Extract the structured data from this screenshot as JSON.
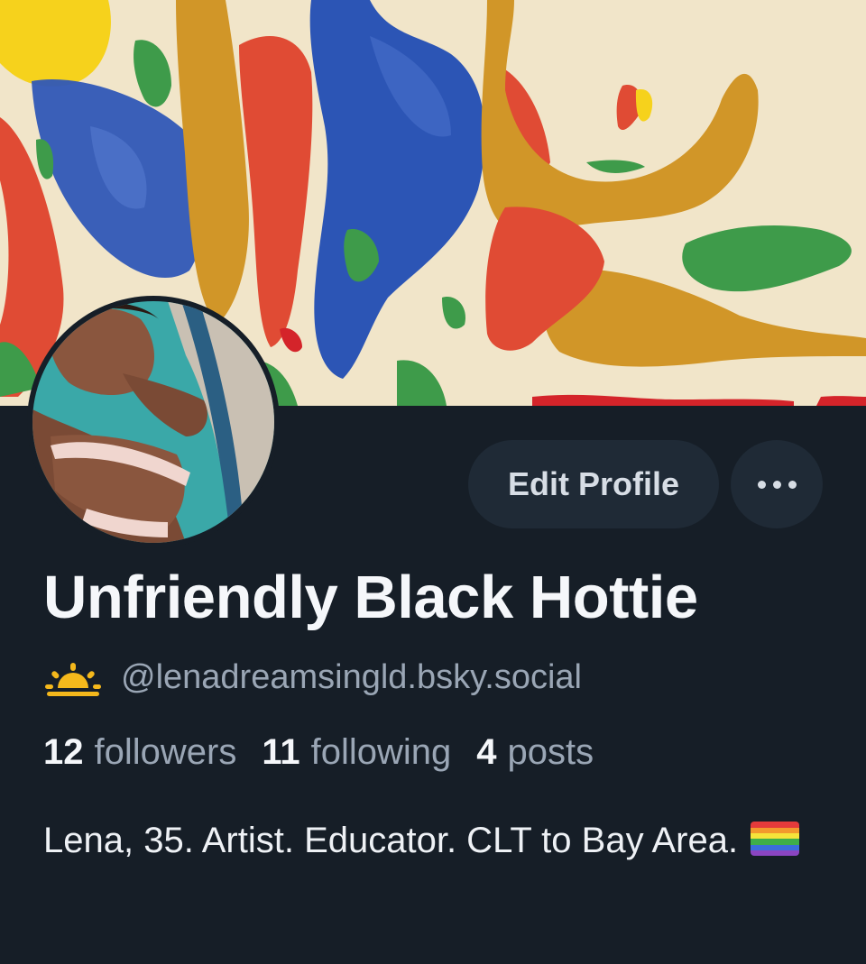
{
  "profile": {
    "display_name": "Unfriendly Black Hottie",
    "handle": "@lenadreamsingld.bsky.social",
    "handle_icon": "sunrise-icon",
    "stats": {
      "followers_count": "12",
      "followers_label": "followers",
      "following_count": "11",
      "following_label": "following",
      "posts_count": "4",
      "posts_label": "posts"
    },
    "bio": "Lena, 35. Artist. Educator. CLT to Bay Area.",
    "bio_icon": "rainbow-flag-icon"
  },
  "actions": {
    "edit_label": "Edit Profile",
    "more_icon": "more-options-icon"
  },
  "colors": {
    "background": "#161e27",
    "button_bg": "#1f2a36",
    "text_primary": "#f5f7fa",
    "text_secondary": "#9aa6b5"
  }
}
